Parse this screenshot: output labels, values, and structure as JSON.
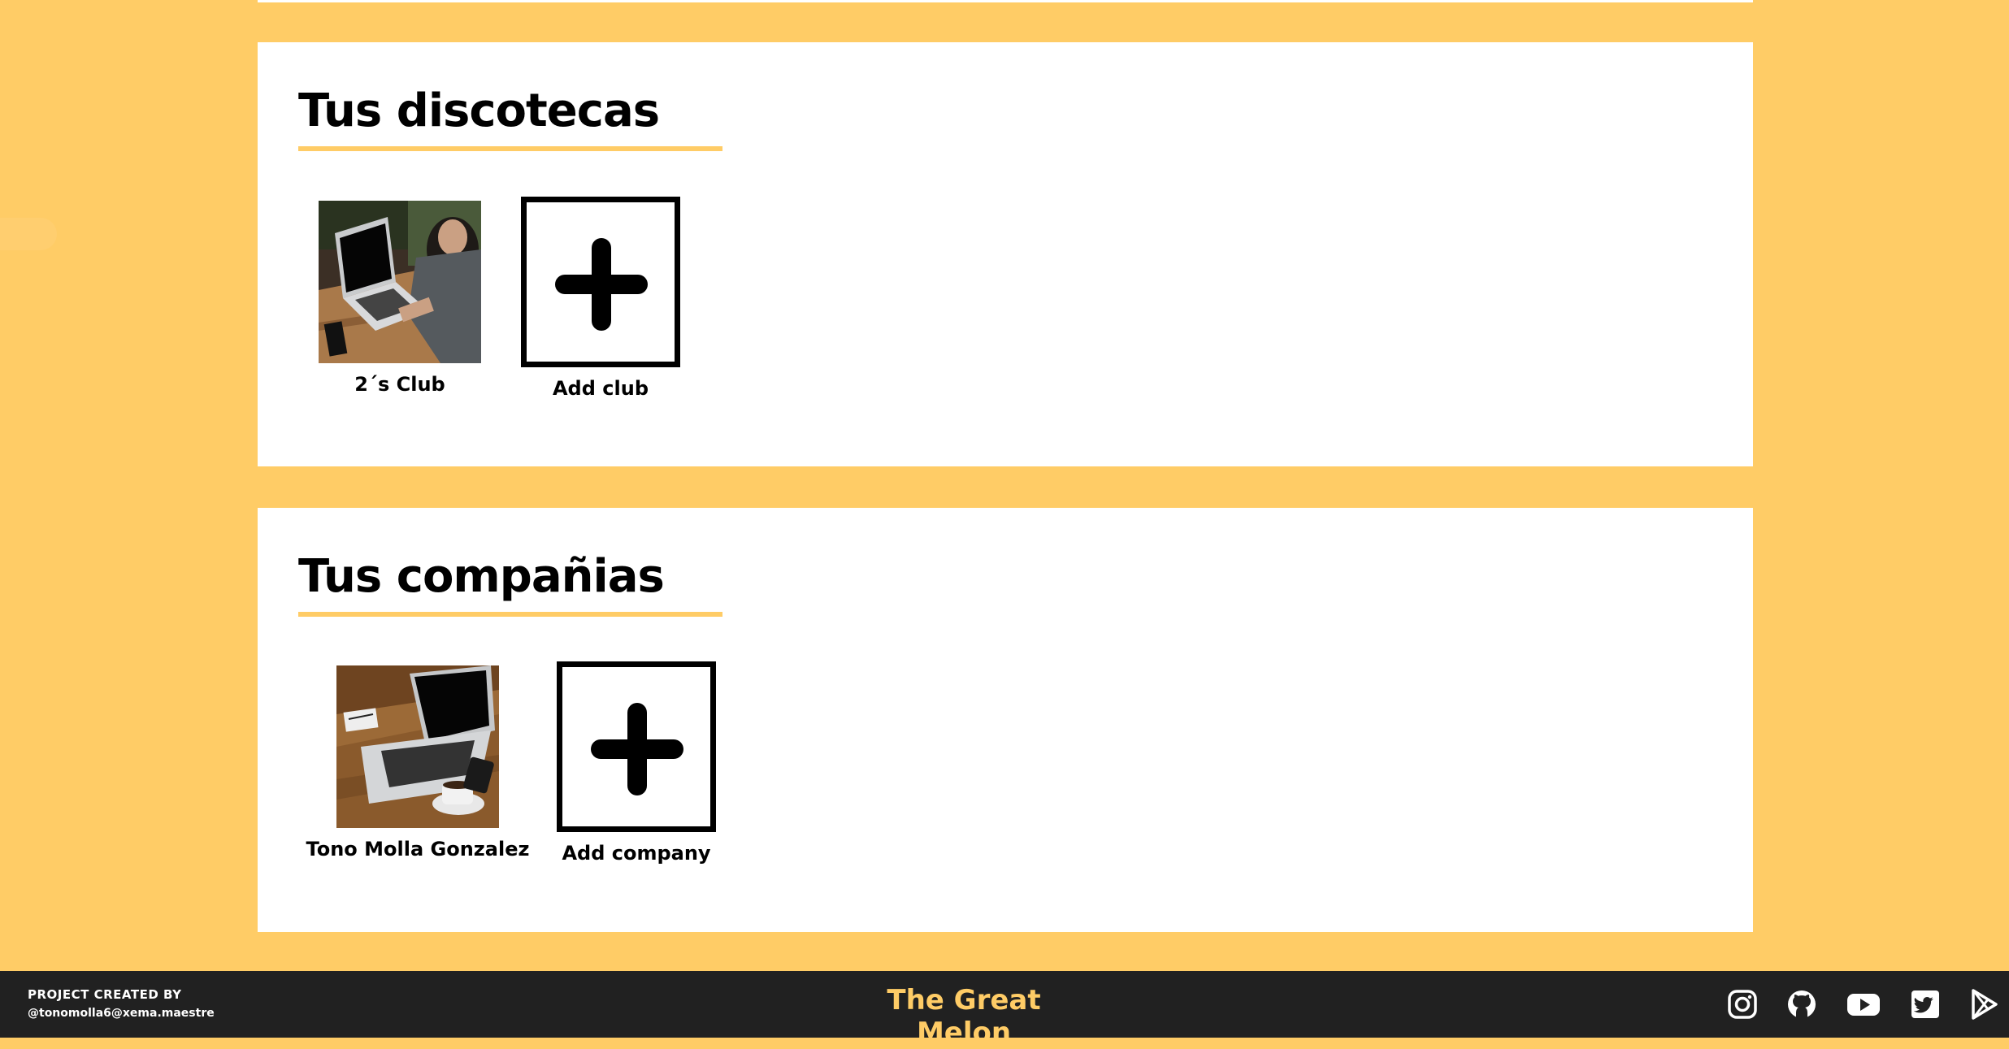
{
  "sections": [
    {
      "title": "Tus discotecas",
      "items": [
        {
          "label": "2´s Club",
          "image": "laptop-person-photo"
        }
      ],
      "add_label": "Add club"
    },
    {
      "title": "Tus compañias",
      "items": [
        {
          "label": "Tono Molla Gonzalez",
          "image": "laptop-coffee-photo"
        }
      ],
      "add_label": "Add company"
    }
  ],
  "footer": {
    "credit_line_1": "PROJECT CREATED BY",
    "credit_line_2": "@tonomolla6@xema.maestre",
    "brand": "The Great Melon",
    "social_icons": [
      "instagram-icon",
      "github-icon",
      "youtube-icon",
      "twitter-icon",
      "google-play-icon"
    ]
  },
  "colors": {
    "background": "#FFCC66",
    "card": "#ffffff",
    "footer": "#212121",
    "accent": "#FFCC66"
  }
}
